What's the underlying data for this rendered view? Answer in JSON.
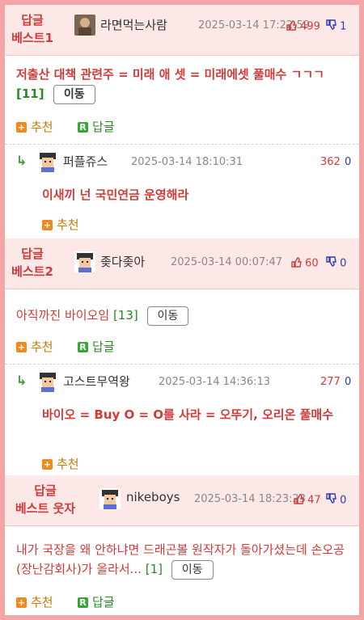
{
  "colors": {
    "accent": "#d23a3a",
    "frame": "#f4a5a5",
    "head_bg": "#fde8e8",
    "count": "#2a8a2a",
    "down": "#2a3bb0"
  },
  "posts": [
    {
      "badge_line1": "답글",
      "badge_line2": "베스트1",
      "nick": "라면먹는사람",
      "date": "2025-03-14 17:22:59",
      "up": "499",
      "down": "1",
      "text": "저출산 대책 관련주 = 미래 애 셋 = 미래에셋 풀매수 ㄱㄱㄱ",
      "count": "[11]",
      "move": "이동",
      "recommend": "추천",
      "reply": "답글",
      "comment": {
        "nick": "퍼플쥬스",
        "date": "2025-03-14 18:10:31",
        "up": "362",
        "down": "0",
        "text": "이새끼 넌 국민연금 운영해라",
        "recommend": "추천"
      }
    },
    {
      "badge_line1": "답글",
      "badge_line2": "베스트2",
      "nick": "좆다좆아",
      "date": "2025-03-14 00:07:47",
      "up": "60",
      "down": "0",
      "text": "아직까진 바이오임",
      "count": "[13]",
      "move": "이동",
      "recommend": "추천",
      "reply": "답글",
      "comment": {
        "nick": "고스트무역왕",
        "date": "2025-03-14 14:36:13",
        "up": "277",
        "down": "0",
        "text": "바이오 = Buy O = O를 사라 = 오뚜기, 오리온 풀매수",
        "recommend": "추천"
      }
    },
    {
      "badge_line1": "답글",
      "badge_line2": "베스트 웃자",
      "nick": "nikeboys",
      "date": "2025-03-14 18:23:23",
      "up": "47",
      "down": "0",
      "text": "내가 국장을 왜 안하냐면 드래곤볼 원작자가 돌아가셨는데 손오공(장난감회사)가 올라서...",
      "count": "[1]",
      "move": "이동",
      "recommend": "추천",
      "reply": "답글"
    }
  ],
  "icons": {
    "up": "thumbs-up-icon",
    "down": "thumbs-down-icon",
    "reply_arrow": "reply-arrow-icon",
    "plus": "plus-box-icon",
    "r": "reply-box-icon"
  }
}
